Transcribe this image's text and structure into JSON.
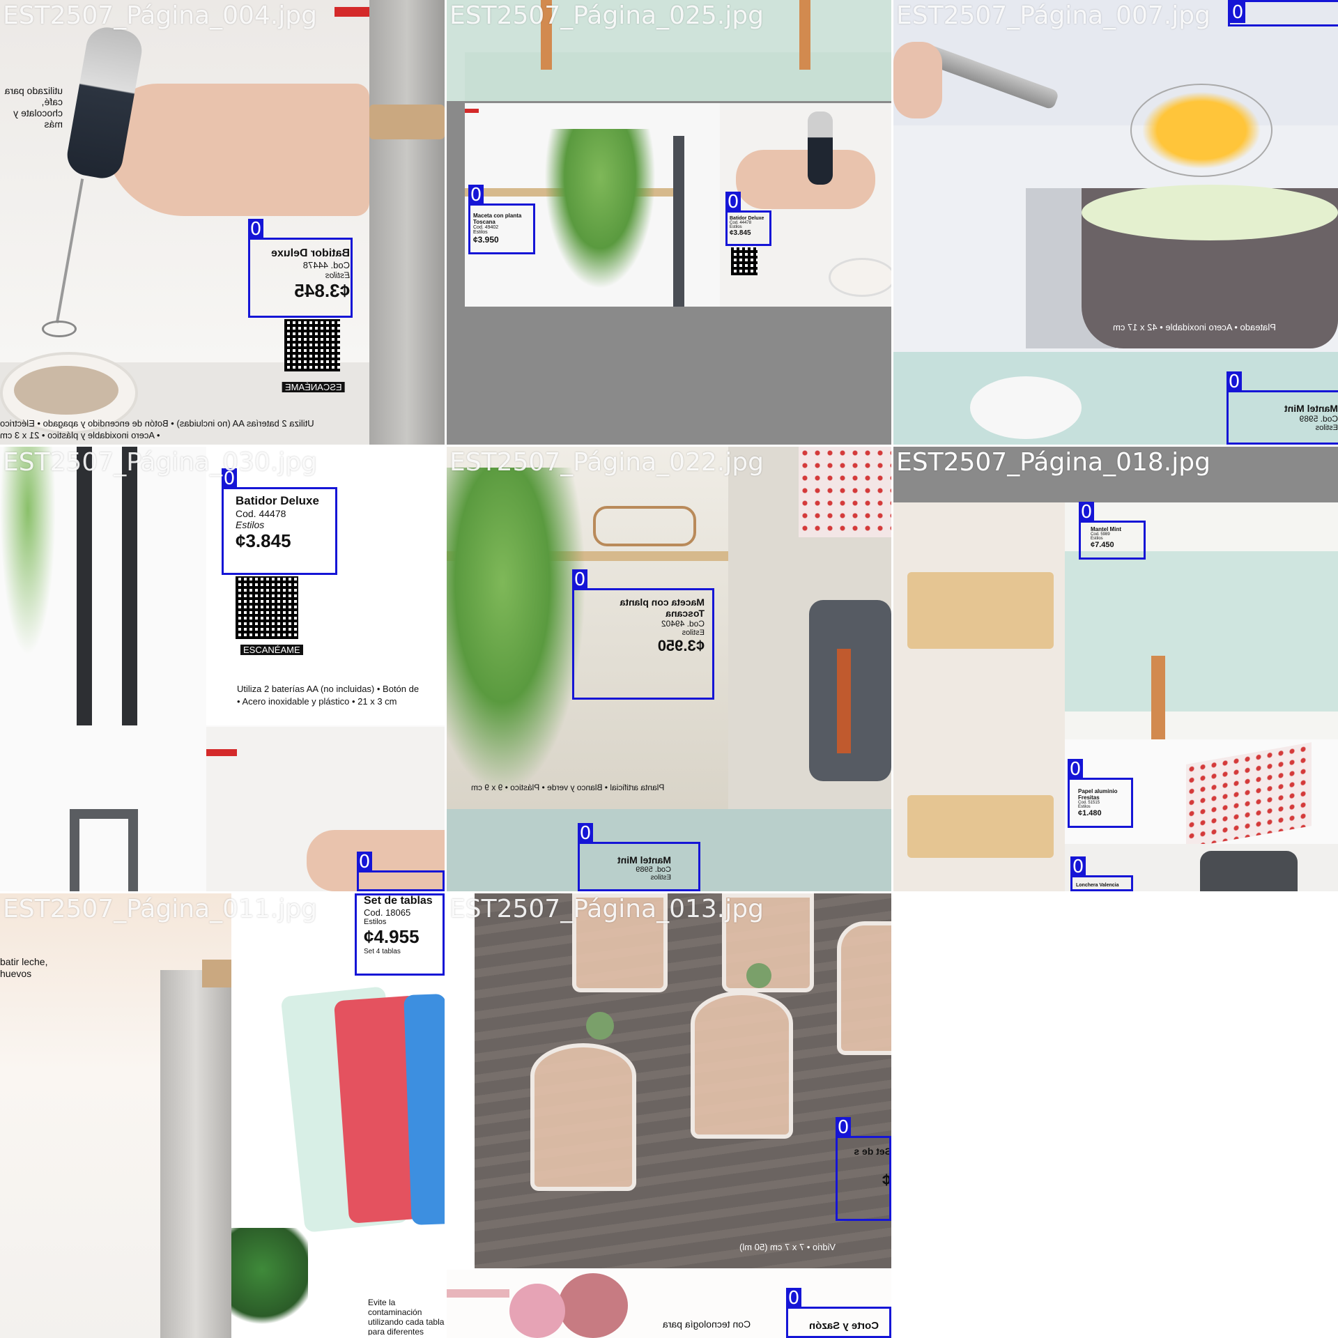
{
  "tiles": [
    {
      "title": "EST2507_Página_004.jpg",
      "label": {
        "name": "Batidor Deluxe",
        "code": "Cod. 44478",
        "style": "Estilos",
        "price": "¢3.845"
      },
      "scan": "ESCANÉAME",
      "desc1": "Utiliza 2 baterías AA (no incluidas) • Botón de encendido y apagado • Eléctrico",
      "desc2": "• Acero inoxidable y plástico • 21 x 3 cm",
      "side": "utilizado para café, chocolate y más",
      "box_id": "0"
    },
    {
      "title": "EST2507_Página_025.jpg",
      "label1": {
        "name": "Maceta con planta Toscana",
        "code": "Cod. 49402",
        "style": "Estilos",
        "price": "¢3.950"
      },
      "label2": {
        "name": "Batidor Deluxe",
        "code": "Cod. 44478",
        "style": "Estilos",
        "price": "¢3.845"
      },
      "box_id": "0"
    },
    {
      "title": "EST2507_Página_007.jpg",
      "caption": "Plateado • Acero inoxidable • 42 x 17 cm",
      "label": {
        "name": "Mantel Mint",
        "code": "Cod. 5989",
        "style": "Estilos"
      },
      "box_id": "0"
    },
    {
      "title": "EST2507_Página_030.jpg",
      "label": {
        "name": "Batidor Deluxe",
        "code": "Cod. 44478",
        "style": "Estilos",
        "price": "¢3.845"
      },
      "scan": "ESCANÉAME",
      "desc1": "Utiliza 2 baterías AA (no incluidas) • Botón de",
      "desc2": "• Acero inoxidable y plástico • 21 x 3 cm",
      "box_id": "0"
    },
    {
      "title": "EST2507_Página_022.jpg",
      "label": {
        "name": "Maceta con planta Toscana",
        "code": "Cod. 49402",
        "style": "Estilos",
        "price": "¢3.950"
      },
      "caption": "Planta artificial • Blanco y verde • Plástico • 9 x 9 cm",
      "label2": {
        "name": "Mantel Mint",
        "code": "Cod. 5989",
        "style": "Estilos"
      },
      "box_id": "0"
    },
    {
      "title": "EST2507_Página_018.jpg",
      "label1": {
        "name": "Mantel Mint",
        "code": "Cod. 5989",
        "style": "Estilos",
        "price": "¢7.450"
      },
      "label2": {
        "name": "Papel aluminio Fresitas",
        "code": "Cod. 51515",
        "style": "Estilos",
        "price": "¢1.480"
      },
      "label3": {
        "name": "Lonchera Valencia"
      },
      "box_id": "0"
    },
    {
      "title": "EST2507_Página_011.jpg",
      "label": {
        "name": "Set de tablas",
        "code": "Cod. 18065",
        "style": "Estilos",
        "price": "¢4.955",
        "extra": "Set 4 tablas"
      },
      "side": "batir leche, huevos",
      "note": "Evite la contaminación utilizando cada tabla para diferentes",
      "box_id": "0"
    },
    {
      "title": "EST2507_Página_013.jpg",
      "caption": "Vidrio • 7 x 7 cm (50 ml)",
      "label1": {
        "name": "Set de shots",
        "price": "¢"
      },
      "label2": {
        "name": "Corte y Sazón"
      },
      "bottom_note": "Con tecnología para",
      "box_id": "0"
    }
  ],
  "colors": {
    "box": "#1515d6",
    "panel_grey": "#8a8a8a",
    "accent_red": "#d42a2a"
  }
}
